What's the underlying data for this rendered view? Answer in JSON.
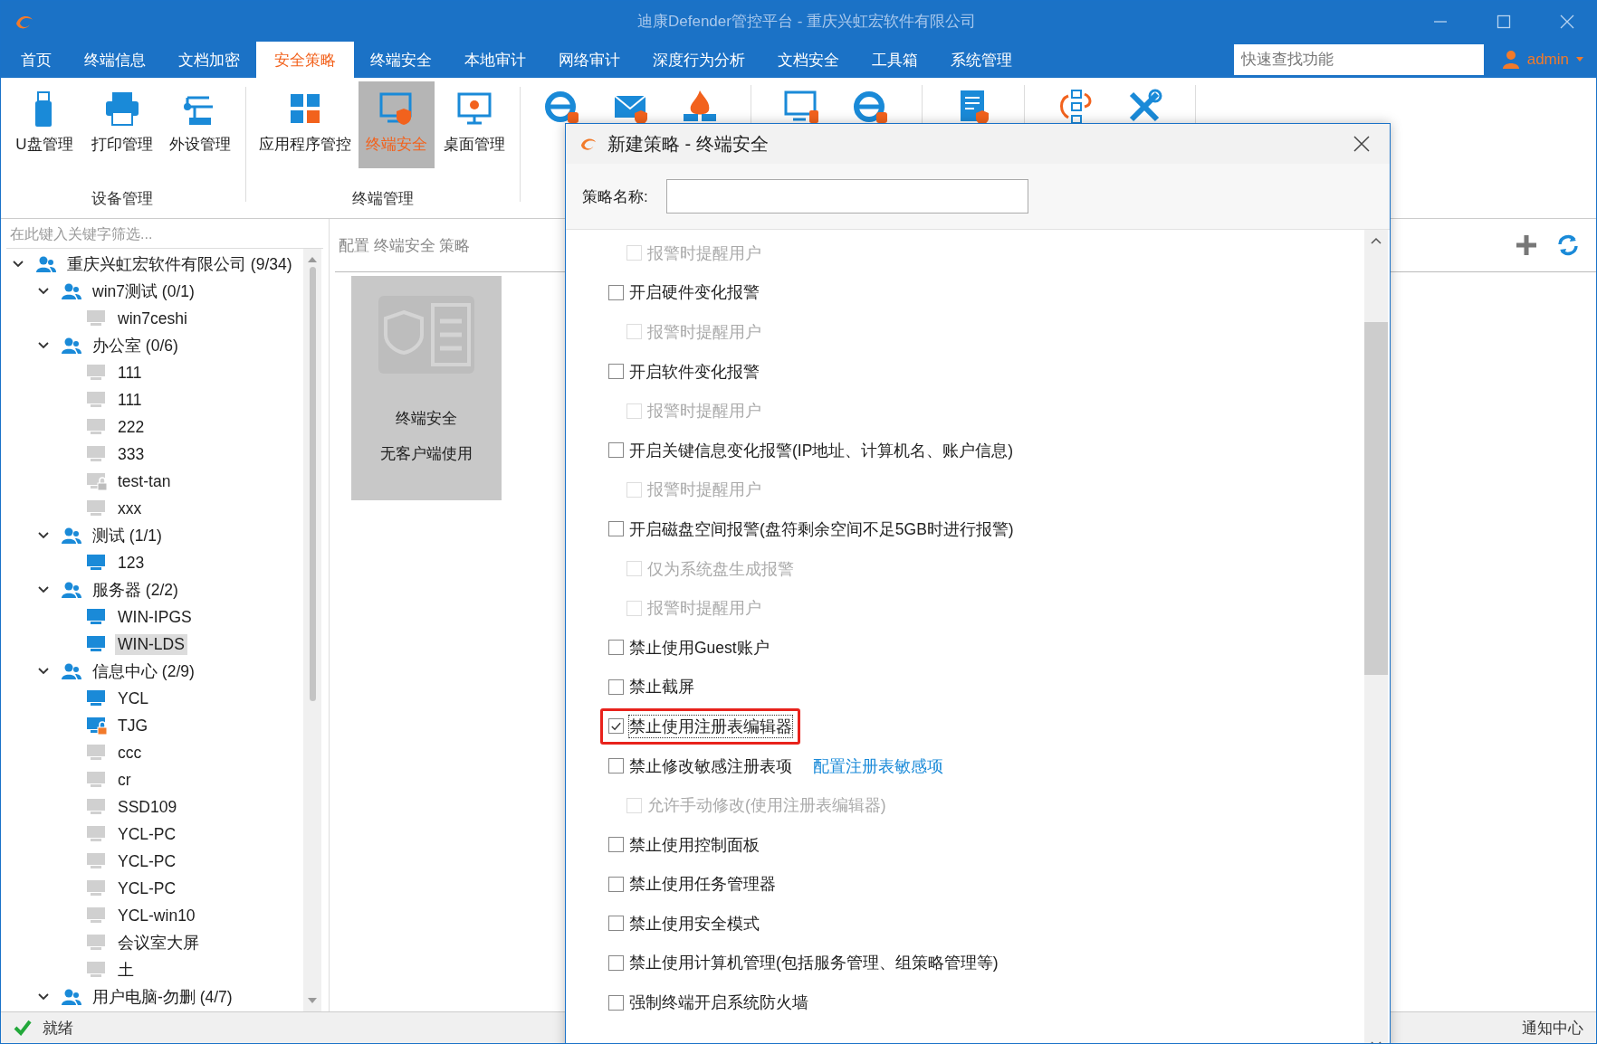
{
  "window": {
    "title": "迪康Defender管控平台 - 重庆兴虹宏软件有限公司"
  },
  "tabs": [
    {
      "label": "首页",
      "selected": false
    },
    {
      "label": "终端信息",
      "selected": false
    },
    {
      "label": "文档加密",
      "selected": false
    },
    {
      "label": "安全策略",
      "selected": true
    },
    {
      "label": "终端安全",
      "selected": false
    },
    {
      "label": "本地审计",
      "selected": false
    },
    {
      "label": "网络审计",
      "selected": false
    },
    {
      "label": "深度行为分析",
      "selected": false
    },
    {
      "label": "文档安全",
      "selected": false
    },
    {
      "label": "工具箱",
      "selected": false
    },
    {
      "label": "系统管理",
      "selected": false
    }
  ],
  "search": {
    "placeholder": "快速查找功能"
  },
  "user": "admin",
  "ribbon": [
    {
      "label": "设备管理",
      "items": [
        {
          "label": "U盘管理",
          "selected": false
        },
        {
          "label": "打印管理",
          "selected": false
        },
        {
          "label": "外设管理",
          "selected": false
        }
      ]
    },
    {
      "label": "终端管理",
      "items": [
        {
          "label": "应用程序管控",
          "selected": false
        },
        {
          "label": "终端安全",
          "selected": true
        },
        {
          "label": "桌面管理",
          "selected": false
        }
      ]
    }
  ],
  "sidebar": {
    "filter_placeholder": "在此键入关键字筛选...",
    "tree": [
      {
        "label": "重庆兴虹宏软件有限公司 (9/34)",
        "kind": "group",
        "expanded": true,
        "children": [
          {
            "label": "win7测试 (0/1)",
            "kind": "group",
            "expanded": true,
            "children": [
              {
                "label": "win7ceshi",
                "kind": "computer",
                "online": false,
                "locked": false,
                "selected": false
              }
            ]
          },
          {
            "label": "办公室 (0/6)",
            "kind": "group",
            "expanded": true,
            "children": [
              {
                "label": "111",
                "kind": "computer",
                "online": false,
                "locked": false,
                "selected": false
              },
              {
                "label": "111",
                "kind": "computer",
                "online": false,
                "locked": false,
                "selected": false
              },
              {
                "label": "222",
                "kind": "computer",
                "online": false,
                "locked": false,
                "selected": false
              },
              {
                "label": "333",
                "kind": "computer",
                "online": false,
                "locked": false,
                "selected": false
              },
              {
                "label": "test-tan",
                "kind": "computer",
                "online": false,
                "locked": true,
                "selected": false
              },
              {
                "label": "xxx",
                "kind": "computer",
                "online": false,
                "locked": false,
                "selected": false
              }
            ]
          },
          {
            "label": "测试 (1/1)",
            "kind": "group",
            "expanded": true,
            "children": [
              {
                "label": "123",
                "kind": "computer",
                "online": true,
                "locked": false,
                "selected": false
              }
            ]
          },
          {
            "label": "服务器 (2/2)",
            "kind": "group",
            "expanded": true,
            "children": [
              {
                "label": "WIN-IPGS",
                "kind": "computer",
                "online": true,
                "locked": false,
                "selected": false
              },
              {
                "label": "WIN-LDS",
                "kind": "computer",
                "online": true,
                "locked": false,
                "selected": true
              }
            ]
          },
          {
            "label": "信息中心 (2/9)",
            "kind": "group",
            "expanded": true,
            "children": [
              {
                "label": "YCL",
                "kind": "computer",
                "online": true,
                "locked": false,
                "selected": false
              },
              {
                "label": "TJG",
                "kind": "computer",
                "online": true,
                "locked": true,
                "selected": false
              },
              {
                "label": "ccc",
                "kind": "computer",
                "online": false,
                "locked": false,
                "selected": false
              },
              {
                "label": "cr",
                "kind": "computer",
                "online": false,
                "locked": false,
                "selected": false
              },
              {
                "label": "SSD109",
                "kind": "computer",
                "online": false,
                "locked": false,
                "selected": false
              },
              {
                "label": "YCL-PC",
                "kind": "computer",
                "online": false,
                "locked": false,
                "selected": false
              },
              {
                "label": "YCL-PC",
                "kind": "computer",
                "online": false,
                "locked": false,
                "selected": false
              },
              {
                "label": "YCL-PC",
                "kind": "computer",
                "online": false,
                "locked": false,
                "selected": false
              },
              {
                "label": "YCL-win10",
                "kind": "computer",
                "online": false,
                "locked": false,
                "selected": false
              },
              {
                "label": "会议室大屏",
                "kind": "computer",
                "online": false,
                "locked": false,
                "selected": false
              },
              {
                "label": "土",
                "kind": "computer",
                "online": false,
                "locked": false,
                "selected": false
              }
            ]
          },
          {
            "label": "用户电脑-勿删 (4/7)",
            "kind": "group",
            "expanded": true
          }
        ]
      }
    ]
  },
  "panel": {
    "header": "配置 终端安全 策略",
    "card": {
      "title": "终端安全",
      "subtitle": "无客户端使用"
    }
  },
  "dialog": {
    "title": "新建策略 - 终端安全",
    "name_label": "策略名称:",
    "options": [
      {
        "children": [
          {
            "label": "报警时提醒用户",
            "checked": false,
            "disabled": true
          }
        ]
      },
      {
        "label": "开启硬件变化报警",
        "checked": false,
        "disabled": false,
        "children": [
          {
            "label": "报警时提醒用户",
            "checked": false,
            "disabled": true
          }
        ]
      },
      {
        "label": "开启软件变化报警",
        "checked": false,
        "disabled": false,
        "children": [
          {
            "label": "报警时提醒用户",
            "checked": false,
            "disabled": true
          }
        ]
      },
      {
        "label": "开启关键信息变化报警(IP地址、计算机名、账户信息)",
        "checked": false,
        "disabled": false,
        "children": [
          {
            "label": "报警时提醒用户",
            "checked": false,
            "disabled": true
          }
        ]
      },
      {
        "label": "开启磁盘空间报警(盘符剩余空间不足5GB时进行报警)",
        "checked": false,
        "disabled": false,
        "children": [
          {
            "label": "仅为系统盘生成报警",
            "checked": false,
            "disabled": true
          },
          {
            "label": "报警时提醒用户",
            "checked": false,
            "disabled": true
          }
        ]
      },
      {
        "label": "禁止使用Guest账户",
        "checked": false,
        "disabled": false
      },
      {
        "label": "禁止截屏",
        "checked": false,
        "disabled": false
      },
      {
        "label": "禁止使用注册表编辑器",
        "checked": true,
        "disabled": false,
        "highlighted": true
      },
      {
        "label": "禁止修改敏感注册表项",
        "checked": false,
        "disabled": false,
        "link": "配置注册表敏感项",
        "children": [
          {
            "label": "允许手动修改(使用注册表编辑器)",
            "checked": false,
            "disabled": true
          }
        ]
      },
      {
        "label": "禁止使用控制面板",
        "checked": false,
        "disabled": false
      },
      {
        "label": "禁止使用任务管理器",
        "checked": false,
        "disabled": false
      },
      {
        "label": "禁止使用安全模式",
        "checked": false,
        "disabled": false
      },
      {
        "label": "禁止使用计算机管理(包括服务管理、组策略管理等)",
        "checked": false,
        "disabled": false
      },
      {
        "label": "强制终端开启系统防火墙",
        "checked": false,
        "disabled": false
      }
    ]
  },
  "status_bar": {
    "text": "就绪",
    "notice": "通知中心"
  }
}
